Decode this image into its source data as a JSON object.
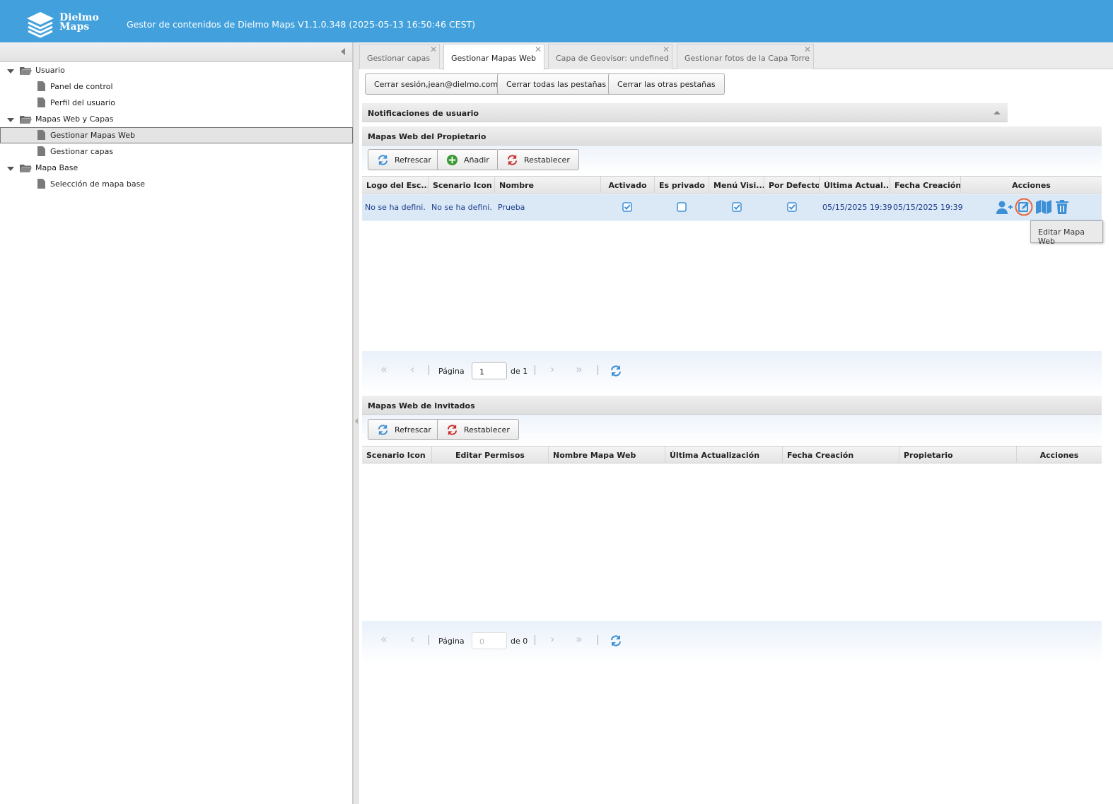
{
  "header": {
    "logo_line1": "Dielmo",
    "logo_line2": "Maps",
    "title": "Gestor de contenidos de Dielmo Maps V1.1.0.348 (2025-05-13 16:50:46 CEST)"
  },
  "sidebar": {
    "items": [
      {
        "label": "Usuario",
        "type": "folder"
      },
      {
        "label": "Panel de control",
        "type": "file"
      },
      {
        "label": "Perfil del usuario",
        "type": "file"
      },
      {
        "label": "Mapas Web y Capas",
        "type": "folder"
      },
      {
        "label": "Gestionar Mapas Web",
        "type": "file",
        "selected": true
      },
      {
        "label": "Gestionar capas",
        "type": "file"
      },
      {
        "label": "Mapa Base",
        "type": "folder"
      },
      {
        "label": "Selección de mapa base",
        "type": "file"
      }
    ]
  },
  "tabs": [
    {
      "label": "Gestionar capas",
      "active": false
    },
    {
      "label": "Gestionar Mapas Web",
      "active": true
    },
    {
      "label": "Capa de Geovisor: undefined",
      "active": false
    },
    {
      "label": "Gestionar fotos de la Capa Torre",
      "active": false
    }
  ],
  "session_buttons": {
    "logout": "Cerrar sesión,jean@dielmo.com",
    "close_all": "Cerrar todas las pestañas",
    "close_others": "Cerrar las otras pestañas"
  },
  "notifications": {
    "title": "Notificaciones de usuario"
  },
  "owner_maps": {
    "title": "Mapas Web del Propietario",
    "refresh": "Refrescar",
    "add": "Añadir",
    "reset": "Restablecer",
    "columns": [
      "Logo del Esc...",
      "Scenario Icon",
      "Nombre",
      "Activado",
      "Es privado",
      "Menú Visi...",
      "Por Defecto",
      "Última Actual...",
      "Fecha Creación",
      "Acciones"
    ],
    "rows": [
      {
        "logo": "No se ha defini...",
        "icon": "No se ha defini...",
        "name": "Prueba",
        "activated": true,
        "private": false,
        "menu_visible": true,
        "default": true,
        "updated": "05/15/2025 19:39",
        "created": "05/15/2025 19:39",
        "actions": [
          "user-add-icon",
          "edit-icon",
          "map-icon",
          "trash-icon"
        ]
      }
    ],
    "pager": {
      "page_label": "Página",
      "page": "1",
      "of_label": "de 1"
    }
  },
  "tooltip": {
    "text": "Editar Mapa Web"
  },
  "guest_maps": {
    "title": "Mapas Web de Invitados",
    "refresh": "Refrescar",
    "reset": "Restablecer",
    "columns": [
      "Scenario Icon",
      "Editar Permisos",
      "Nombre Mapa Web",
      "Última Actualización",
      "Fecha Creación",
      "Propietario",
      "Acciones"
    ],
    "pager": {
      "page_label": "Página",
      "page": "0",
      "of_label": "de 0"
    }
  },
  "colors": {
    "header_bg": "#42a1dc",
    "accent_blue": "#3d8fd6",
    "row_selected": "#dbe9f7",
    "edit_highlight": "#e8653a"
  }
}
